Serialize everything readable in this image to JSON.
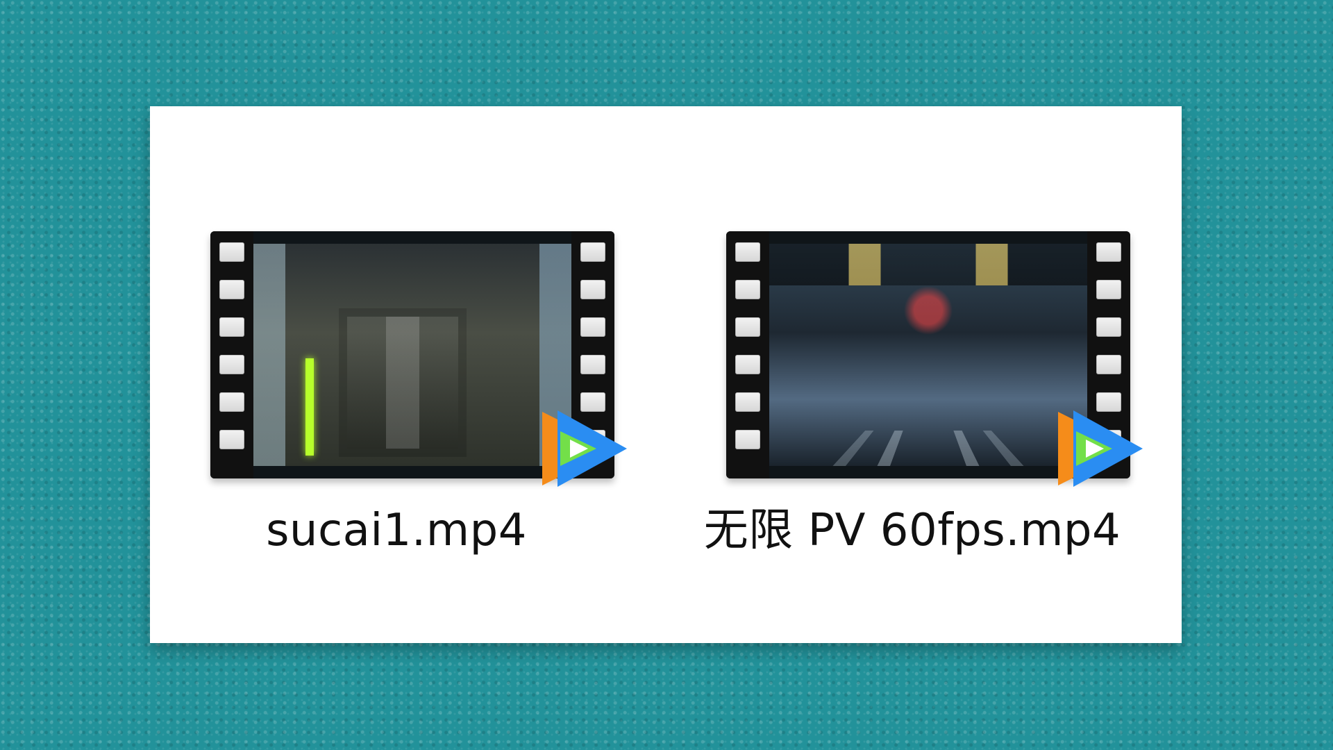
{
  "colors": {
    "desktop_background": "#22929a",
    "panel_background": "#ffffff",
    "text": "#111111",
    "player_orange": "#f58c1a",
    "player_blue": "#2a8df2",
    "player_green": "#73df49"
  },
  "files": [
    {
      "name": "sucai1.mp4",
      "icon": "video-file-icon",
      "badge_icon": "tencent-video-player-icon"
    },
    {
      "name": "无限 PV 60fps.mp4",
      "icon": "video-file-icon",
      "badge_icon": "tencent-video-player-icon"
    }
  ]
}
